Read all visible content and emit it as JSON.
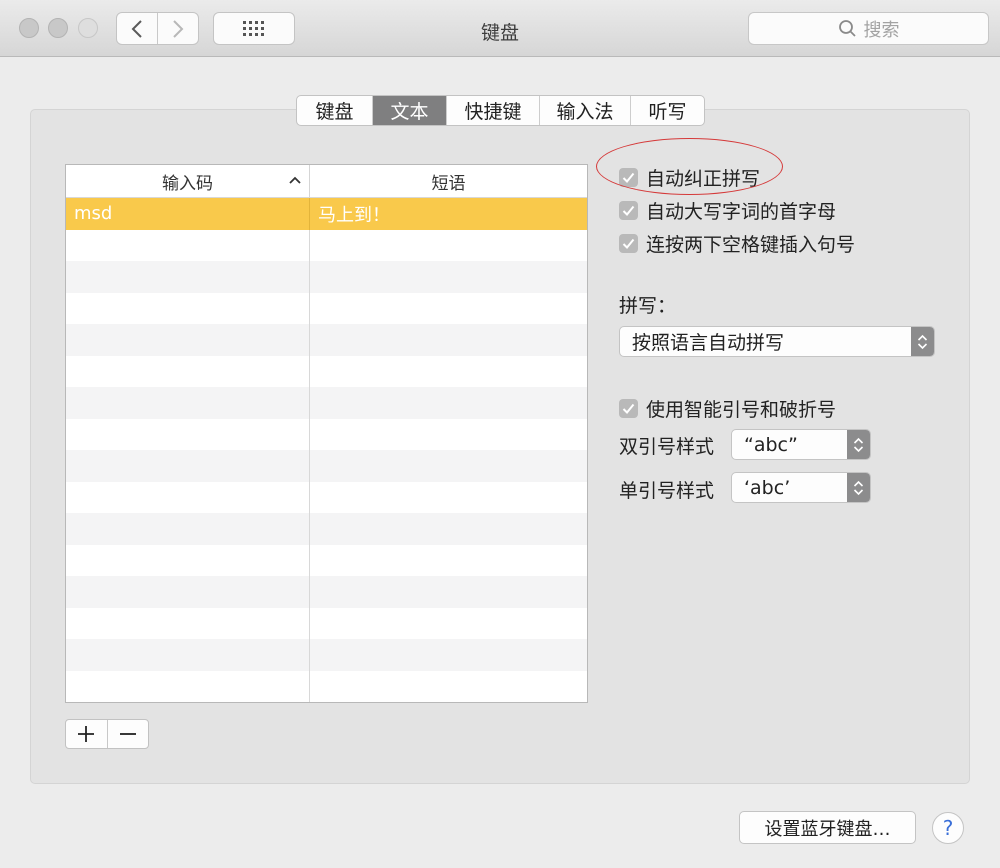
{
  "window": {
    "title": "键盘"
  },
  "toolbar": {
    "search_placeholder": "搜索"
  },
  "tabs": [
    {
      "label": "键盘",
      "selected": false
    },
    {
      "label": "文本",
      "selected": true
    },
    {
      "label": "快捷键",
      "selected": false
    },
    {
      "label": "输入法",
      "selected": false
    },
    {
      "label": "听写",
      "selected": false
    }
  ],
  "table": {
    "columns": [
      "输入码",
      "短语"
    ],
    "rows": [
      {
        "code": "msd",
        "phrase": "马上到！",
        "selected": true
      }
    ]
  },
  "buttons": {
    "add": "+",
    "remove": "−",
    "bluetooth": "设置蓝牙键盘…",
    "help": "?"
  },
  "options": {
    "autocorrect": {
      "label": "自动纠正拼写",
      "checked": true
    },
    "autocap": {
      "label": "自动大写字词的首字母",
      "checked": true
    },
    "period": {
      "label": "连按两下空格键插入句号",
      "checked": true
    },
    "spelling_label": "拼写：",
    "spelling_value": "按照语言自动拼写",
    "smart_quotes": {
      "label": "使用智能引号和破折号",
      "checked": true
    },
    "double_label": "双引号样式",
    "double_value": "“abc”",
    "single_label": "单引号样式",
    "single_value": "‘abc’"
  },
  "colors": {
    "selection": "#f9c94b",
    "annotation": "#d53a3a",
    "selected_tab": "#7f7f80"
  }
}
